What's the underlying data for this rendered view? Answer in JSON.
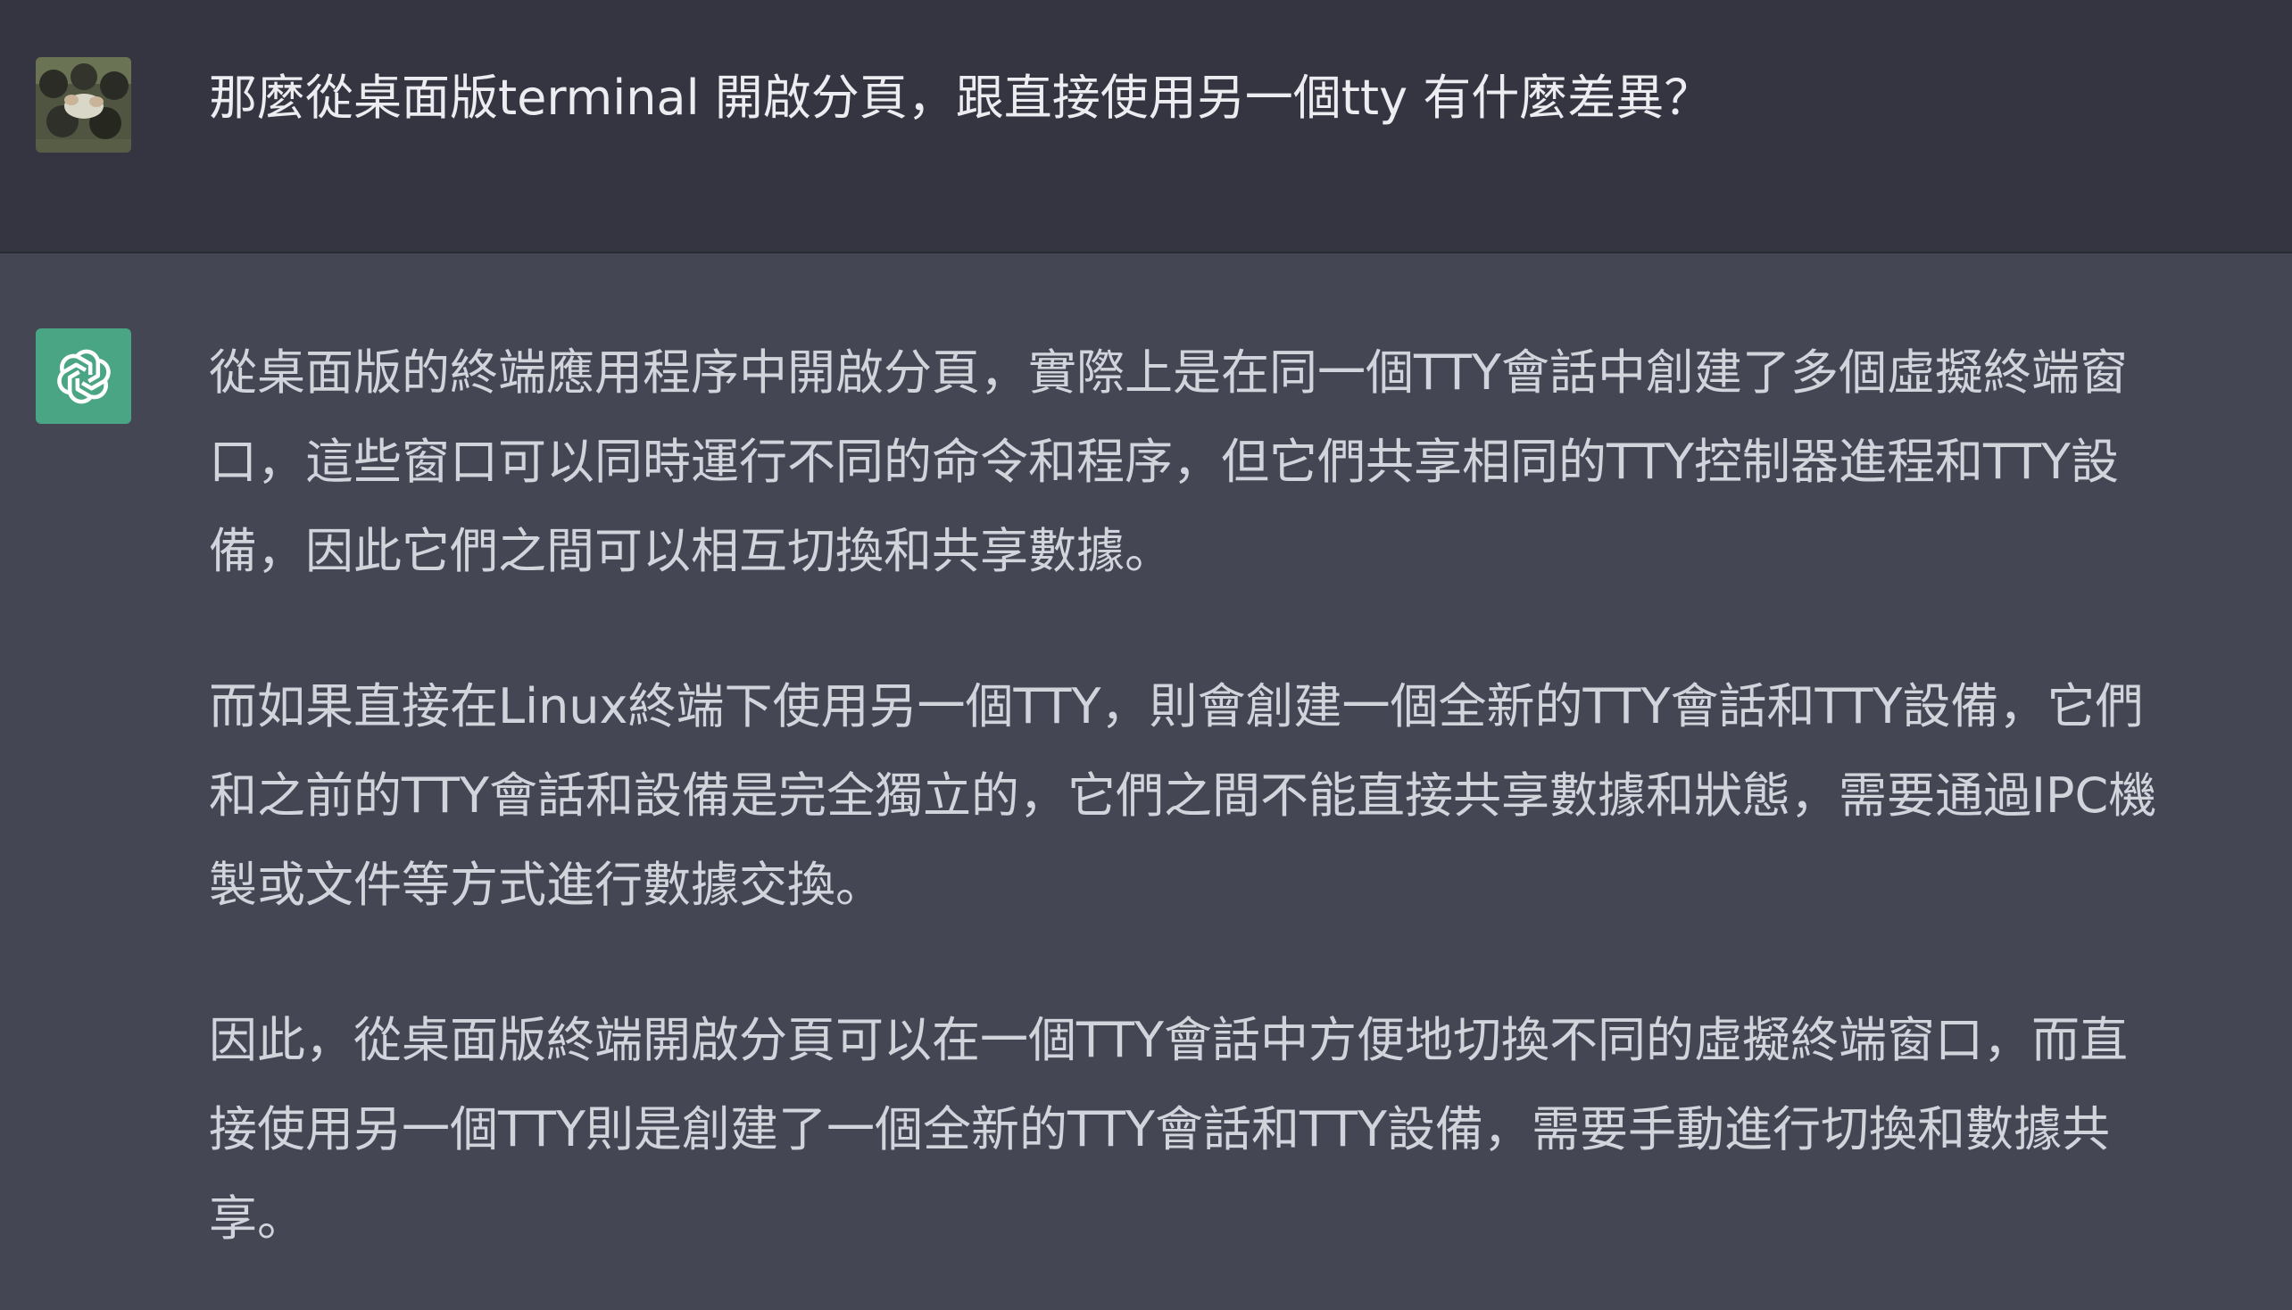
{
  "user_message": {
    "text": "那麼從桌面版terminal 開啟分頁，跟直接使用另一個tty 有什麼差異？"
  },
  "assistant_message": {
    "paragraphs": [
      {
        "lines": [
          "從桌面版的終端應用程序中開啟分頁，實際上是在同一個TTY會話中創建了多個虛擬終端窗",
          "口，這些窗口可以同時運行不同的命令和程序，但它們共享相同的TTY控制器進程和TTY設",
          "備，因此它們之間可以相互切換和共享數據。"
        ]
      },
      {
        "lines": [
          "而如果直接在Linux終端下使用另一個TTY，則會創建一個全新的TTY會話和TTY設備，它們",
          "和之前的TTY會話和設備是完全獨立的，它們之間不能直接共享數據和狀態，需要通過IPC機",
          "製或文件等方式進行數據交換。"
        ]
      },
      {
        "lines": [
          "因此，從桌面版終端開啟分頁可以在一個TTY會話中方便地切換不同的虛擬終端窗口，而直",
          "接使用另一個TTY則是創建了一個全新的TTY會話和TTY設備，需要手動進行切換和數據共",
          "享。"
        ]
      }
    ]
  },
  "icons": {
    "user_avatar": "user-photo-avatar",
    "assistant_avatar": "openai-logo-icon"
  },
  "colors": {
    "user_row_bg": "#343541",
    "assistant_row_bg": "#444654",
    "assistant_avatar_bg": "#4aa584",
    "text": "#ececf1"
  }
}
